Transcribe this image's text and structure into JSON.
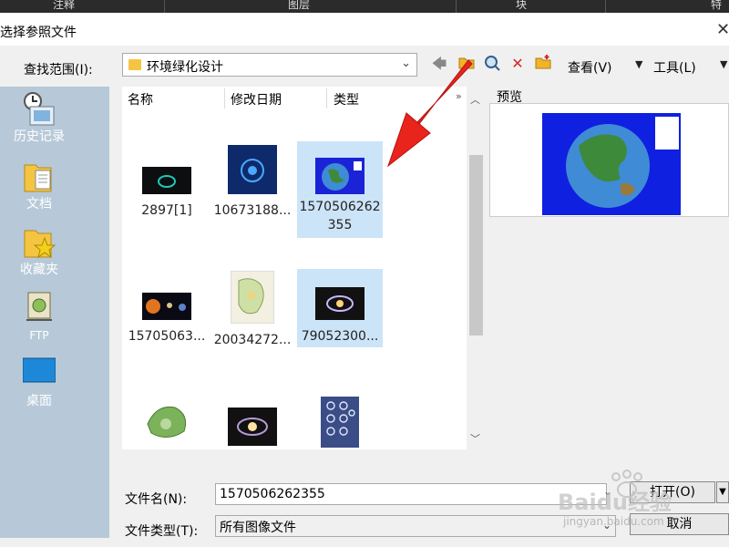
{
  "topbar": {
    "items": [
      "注释",
      "图层",
      "块",
      "特"
    ]
  },
  "dialog": {
    "title": "选择参照文件"
  },
  "lookin": {
    "label": "查找范围(I):",
    "value": "环境绿化设计"
  },
  "toolbar": {
    "view_label": "查看(V)",
    "tools_label": "工具(L)"
  },
  "sidebar": {
    "items": [
      {
        "label": "历史记录",
        "icon": "history-icon"
      },
      {
        "label": "文档",
        "icon": "documents-icon"
      },
      {
        "label": "收藏夹",
        "icon": "favorites-icon"
      },
      {
        "label": "FTP",
        "icon": "ftp-icon"
      },
      {
        "label": "桌面",
        "icon": "desktop-icon"
      }
    ]
  },
  "columns": [
    "名称",
    "修改日期",
    "类型"
  ],
  "files": [
    {
      "name": "2897[1]",
      "thumb": "galaxy-ring"
    },
    {
      "name": "10673188...",
      "thumb": "blue-tech"
    },
    {
      "name": "1570506262355",
      "thumb": "globe",
      "selected": true
    },
    {
      "name": "15705063...",
      "thumb": "planets"
    },
    {
      "name": "20034272...",
      "thumb": "site-plan"
    },
    {
      "name": "79052300...",
      "thumb": "spiral-galaxy",
      "hover": true
    },
    {
      "name": "",
      "thumb": "island"
    },
    {
      "name": "",
      "thumb": "spiral-galaxy-2"
    },
    {
      "name": "",
      "thumb": "snowflakes"
    }
  ],
  "preview": {
    "label": "预览"
  },
  "filename": {
    "label": "文件名(N):",
    "value": "1570506262355"
  },
  "filetype": {
    "label": "文件类型(T):",
    "value": "所有图像文件"
  },
  "buttons": {
    "open": "打开(O)",
    "cancel": "取消"
  },
  "watermark": {
    "brand": "Baidu经验",
    "url": "jingyan.baidu.com"
  },
  "colors": {
    "sidebar": "#b7c9d8",
    "selection": "#cce4f7",
    "arrow": "#e8241c"
  }
}
